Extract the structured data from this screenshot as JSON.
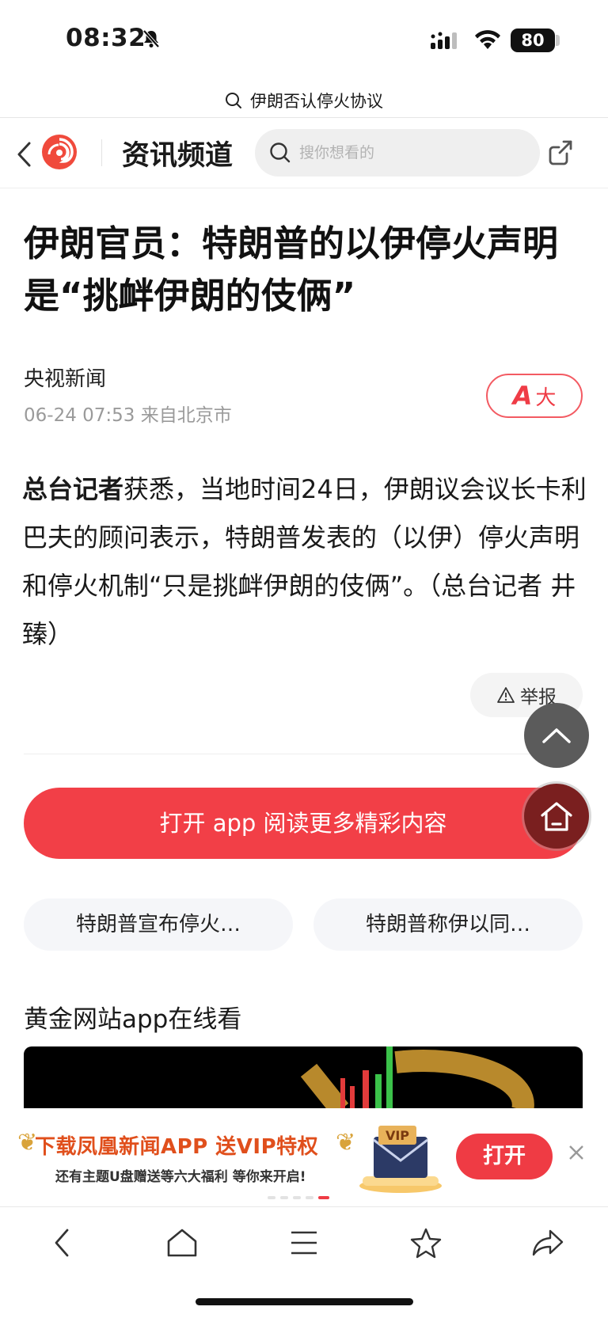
{
  "status_bar": {
    "time": "08:32",
    "battery": "80"
  },
  "url_bar": {
    "text": "伊朗否认停火协议"
  },
  "header": {
    "channel": "资讯频道",
    "search_placeholder": "搜你想看的"
  },
  "article": {
    "title": "伊朗官员：特朗普的以伊停火声明是“挑衅伊朗的伎俩”",
    "source": "央视新闻",
    "meta": "06-24 07:53 来自北京市",
    "font_button_a": "A",
    "font_button_label": "大",
    "lead_bold": "总台记者",
    "body": "获悉，当地时间24日，伊朗议会议长卡利巴夫的顾问表示，特朗普发表的（以伊）停火声明和停火机制“只是挑衅伊朗的伎俩”。（总台记者 井臻）",
    "report_label": "举报"
  },
  "open_app_label": "打开 app 阅读更多精彩内容",
  "related_tags": [
    "特朗普宣布停火…",
    "特朗普称伊以同…"
  ],
  "section_title": "黄金网站app在线看",
  "promo": {
    "title": "下载凤凰新闻APP 送VIP特权",
    "subtitle": "还有主题U盘赠送等六大福利  等你来开启!",
    "badge": "VIP",
    "open_label": "打开"
  },
  "colors": {
    "brand_red": "#f23f47",
    "promo_orange": "#e04f1c"
  }
}
